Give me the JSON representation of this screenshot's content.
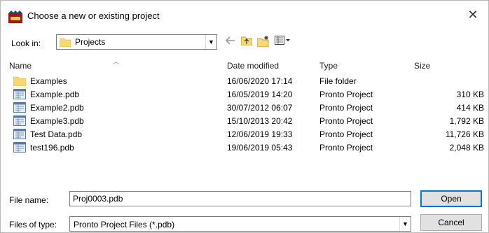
{
  "window": {
    "title": "Choose a new or existing project"
  },
  "lookin": {
    "label": "Look in:",
    "value": "Projects"
  },
  "icons": {
    "app": "app-icon",
    "close": "close-icon",
    "back": "back-arrow-icon",
    "up": "up-folder-icon",
    "new_folder": "new-folder-icon",
    "view_menu": "view-menu-icon",
    "dropdown": "chevron-down-icon",
    "folder": "folder-icon",
    "file": "pdb-file-icon"
  },
  "columns": {
    "name": "Name",
    "date": "Date modified",
    "type": "Type",
    "size": "Size"
  },
  "files": [
    {
      "name": "Examples",
      "date": "16/06/2020 17:14",
      "type": "File folder",
      "size": "",
      "kind": "folder"
    },
    {
      "name": "Example.pdb",
      "date": "16/05/2019 14:20",
      "type": "Pronto Project",
      "size": "310 KB",
      "kind": "file"
    },
    {
      "name": "Example2.pdb",
      "date": "30/07/2012 06:07",
      "type": "Pronto Project",
      "size": "414 KB",
      "kind": "file"
    },
    {
      "name": "Example3.pdb",
      "date": "15/10/2013 20:42",
      "type": "Pronto Project",
      "size": "1,792 KB",
      "kind": "file"
    },
    {
      "name": "Test Data.pdb",
      "date": "12/06/2019 19:33",
      "type": "Pronto Project",
      "size": "11,726 KB",
      "kind": "file"
    },
    {
      "name": "test196.pdb",
      "date": "19/06/2019 05:43",
      "type": "Pronto Project",
      "size": "2,048 KB",
      "kind": "file"
    }
  ],
  "filename": {
    "label": "File name:",
    "value": "Proj0003.pdb"
  },
  "filetype": {
    "label": "Files of type:",
    "value": "Pronto Project Files (*.pdb)"
  },
  "buttons": {
    "open": "Open",
    "cancel": "Cancel"
  },
  "colors": {
    "folder": "#f8d775",
    "accent": "#0078d7",
    "app_icon": "#a31515"
  }
}
